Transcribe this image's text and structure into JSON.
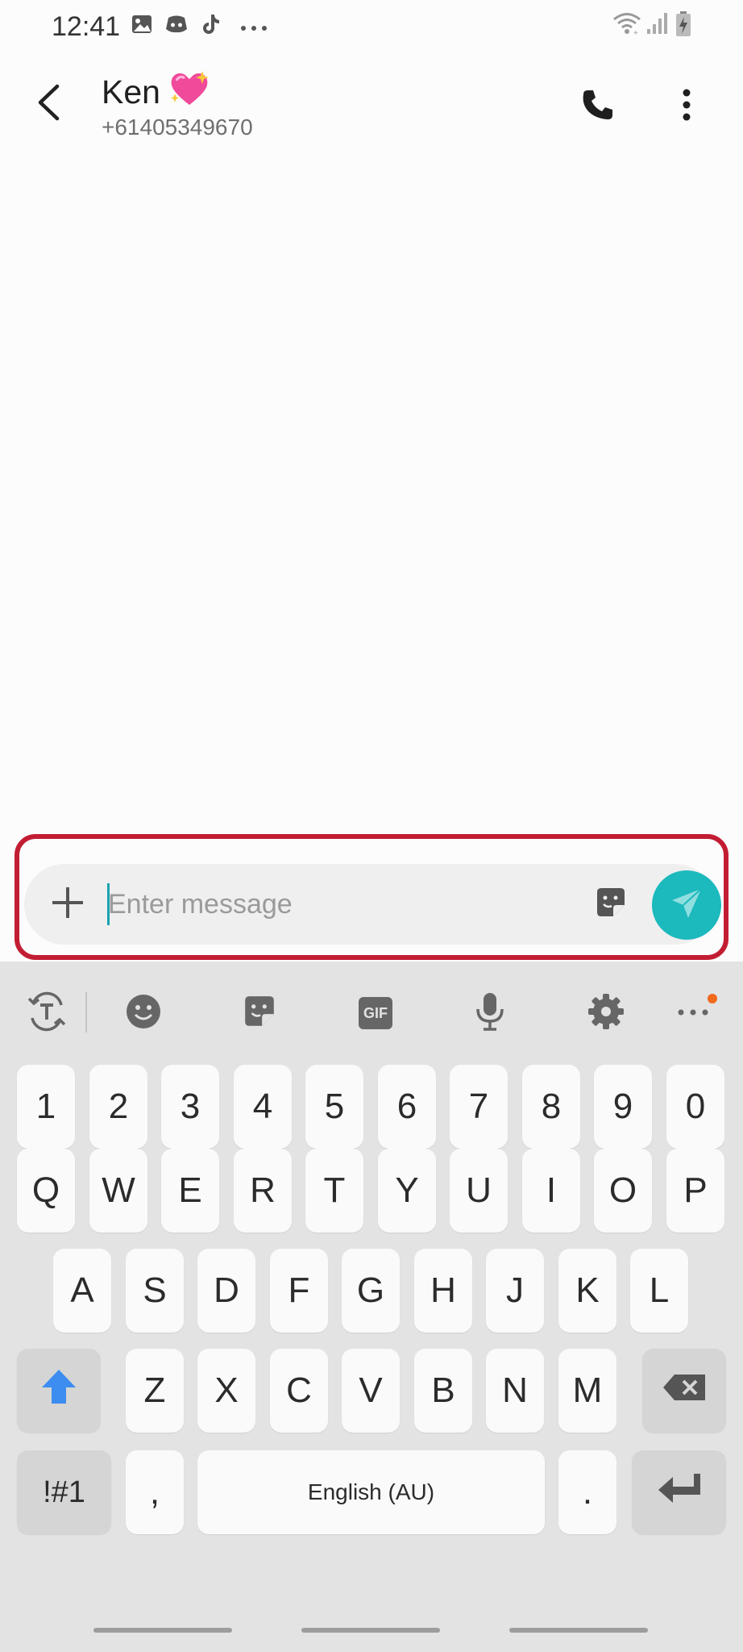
{
  "status_bar": {
    "time": "12:41",
    "left_icons": [
      "gallery-icon",
      "discord-icon",
      "tiktok-icon",
      "more-notifications-icon"
    ],
    "right_icons": [
      "wifi-icon",
      "signal-icon",
      "battery-charging-icon"
    ]
  },
  "header": {
    "contact_name": "Ken",
    "contact_emoji": "💖",
    "contact_number": "+61405349670",
    "back_icon": "back-arrow-icon",
    "call_icon": "phone-icon",
    "more_icon": "more-vertical-icon"
  },
  "composer": {
    "placeholder": "Enter message",
    "value": "",
    "attach_icon": "plus-icon",
    "sticker_icon": "sticker-icon",
    "send_icon": "send-icon",
    "highlight_color": "#c21d33",
    "send_color": "#1cb9bd"
  },
  "keyboard": {
    "toolbar": [
      "text-translate-icon",
      "emoji-icon",
      "sticker-icon",
      "gif-icon",
      "microphone-icon",
      "settings-icon",
      "more-horizontal-icon"
    ],
    "gif_label": "GIF",
    "rows": {
      "numbers": [
        "1",
        "2",
        "3",
        "4",
        "5",
        "6",
        "7",
        "8",
        "9",
        "0"
      ],
      "row1": [
        "Q",
        "W",
        "E",
        "R",
        "T",
        "Y",
        "U",
        "I",
        "O",
        "P"
      ],
      "row2": [
        "A",
        "S",
        "D",
        "F",
        "G",
        "H",
        "J",
        "K",
        "L"
      ],
      "row3": [
        "Z",
        "X",
        "C",
        "V",
        "B",
        "N",
        "M"
      ]
    },
    "shift_icon": "shift-arrow-icon",
    "backspace_icon": "backspace-icon",
    "symbols_label": "!#1",
    "comma_label": ",",
    "space_label": "English (AU)",
    "period_label": ".",
    "enter_icon": "enter-icon"
  }
}
